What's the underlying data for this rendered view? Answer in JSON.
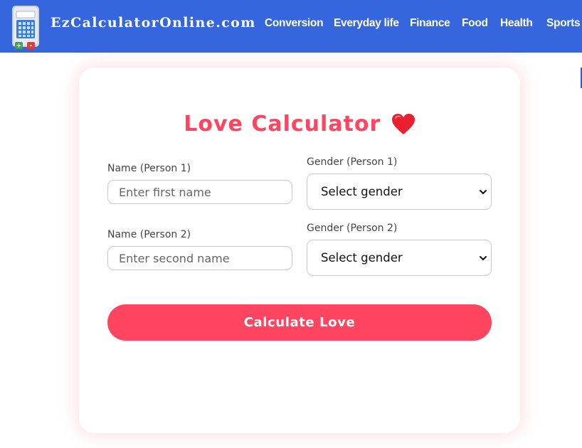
{
  "header": {
    "brand": "EzCalculatorOnline.com",
    "logo_icon": "calculator-icon",
    "nav": [
      "Conversion",
      "Everyday life",
      "Finance",
      "Food",
      "Health",
      "Sports"
    ]
  },
  "form": {
    "title": "Love Calculator",
    "title_icon": "heart-icon",
    "name1_label": "Name (Person 1)",
    "name1_placeholder": "Enter first name",
    "name1_value": "",
    "gender1_label": "Gender (Person 1)",
    "gender1_selected": "Select gender",
    "name2_label": "Name (Person 2)",
    "name2_placeholder": "Enter second name",
    "name2_value": "",
    "gender2_label": "Gender (Person 2)",
    "gender2_selected": "Select gender",
    "submit_label": "Calculate Love"
  },
  "colors": {
    "header_bg": "#3666de",
    "accent": "#ff4560",
    "text": "#444444"
  }
}
